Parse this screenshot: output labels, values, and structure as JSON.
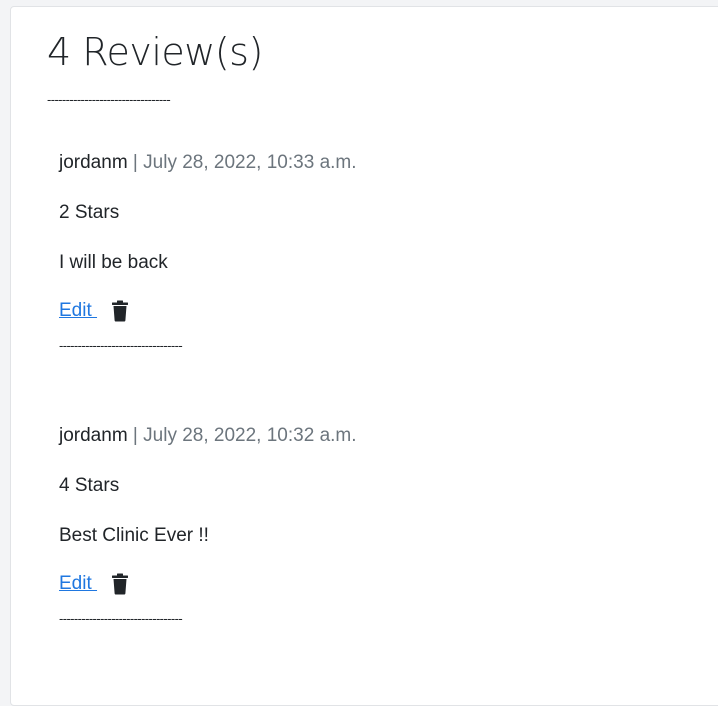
{
  "heading": "4 Review(s)",
  "divider": "---------------------------------",
  "reviews": [
    {
      "author": "jordanm",
      "separator": " | ",
      "date": "July 28, 2022, 10:33 a.m.",
      "stars": "2 Stars",
      "body": "I will be back",
      "edit_label": "Edit ",
      "delete_icon": "trash-icon"
    },
    {
      "author": "jordanm",
      "separator": " | ",
      "date": "July 28, 2022, 10:32 a.m.",
      "stars": "4 Stars",
      "body": "Best Clinic Ever !!",
      "edit_label": "Edit ",
      "delete_icon": "trash-icon"
    }
  ],
  "colors": {
    "link": "#1f77e0",
    "text": "#212529",
    "muted": "#6c757d"
  }
}
